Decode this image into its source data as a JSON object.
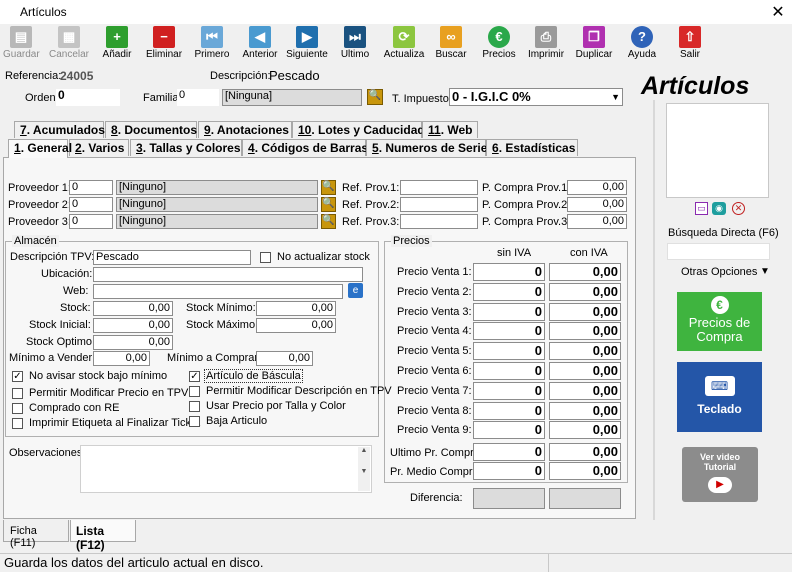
{
  "window": {
    "title": "Artículos",
    "close": "✕"
  },
  "toolbar": {
    "guardar": "Guardar",
    "cancelar": "Cancelar",
    "anadir": "Añadir",
    "eliminar": "Eliminar",
    "primero": "Primero",
    "anterior": "Anterior",
    "siguiente": "Siguiente",
    "ultimo": "Ultimo",
    "actualiza": "Actualiza",
    "buscar": "Buscar",
    "precios": "Precios",
    "imprimir": "Imprimir",
    "duplicar": "Duplicar",
    "ayuda": "Ayuda",
    "salir": "Salir"
  },
  "header": {
    "referencia_label": "Referencia:",
    "referencia_value": "24005",
    "descripcion_label": "Descripción:",
    "descripcion_value": "Pescado",
    "orden_label": "Orden:",
    "orden_value": "0",
    "familia_label": "Familia:",
    "familia_value": "0",
    "familia_name": "[Ninguna]",
    "impuesto_label": "T. Impuesto:",
    "impuesto_value": "0 - I.G.I.C 0%",
    "big_title": "Artículos"
  },
  "tabs_top": [
    {
      "num": "7",
      "label": ". Acumulados"
    },
    {
      "num": "8",
      "label": ". Documentos"
    },
    {
      "num": "9",
      "label": ". Anotaciones"
    },
    {
      "num": "10",
      "label": ". Lotes y Caducidad"
    },
    {
      "num": "11",
      "label": ". Web"
    }
  ],
  "tabs_bottom": [
    {
      "num": "1",
      "label": ". General"
    },
    {
      "num": "2",
      "label": ". Varios"
    },
    {
      "num": "3",
      "label": ". Tallas y Colores"
    },
    {
      "num": "4",
      "label": ". Códigos de Barras"
    },
    {
      "num": "5",
      "label": ". Numeros de Serie"
    },
    {
      "num": "6",
      "label": ". Estadísticas"
    }
  ],
  "proveedores": [
    {
      "label": "Proveedor 1:",
      "code": "0",
      "name": "[Ninguno]",
      "ref_label": "Ref. Prov.1:",
      "ref": "",
      "price_label": "P. Compra Prov.1:",
      "price": "0,00"
    },
    {
      "label": "Proveedor 2:",
      "code": "0",
      "name": "[Ninguno]",
      "ref_label": "Ref. Prov.2:",
      "ref": "",
      "price_label": "P. Compra Prov.2:",
      "price": "0,00"
    },
    {
      "label": "Proveedor 3:",
      "code": "0",
      "name": "[Ninguno]",
      "ref_label": "Ref. Prov.3:",
      "ref": "",
      "price_label": "P. Compra Prov.3:",
      "price": "0,00"
    }
  ],
  "almacen": {
    "title": "Almacén",
    "desc_tpv_label": "Descripción TPV:",
    "desc_tpv_value": "Pescado",
    "no_actualizar": "No actualizar stock",
    "ubicacion_label": "Ubicación:",
    "web_label": "Web:",
    "stock_label": "Stock:",
    "stock_value": "0,00",
    "stock_min_label": "Stock Mínimo:",
    "stock_min_value": "0,00",
    "stock_ini_label": "Stock Inicial:",
    "stock_ini_value": "0,00",
    "stock_max_label": "Stock Máximo:",
    "stock_max_value": "0,00",
    "stock_opt_label": "Stock Optimo:",
    "stock_opt_value": "0,00",
    "min_vender_label": "Mínimo a Vender:",
    "min_vender_value": "0,00",
    "min_comprar_label": "Mínimo a Comprar:",
    "min_comprar_value": "0,00",
    "checks_left": [
      {
        "label": "No avisar stock bajo mínimo",
        "checked": true
      },
      {
        "label": "Permitir Modificar Precio en TPV",
        "checked": false
      },
      {
        "label": "Comprado con RE",
        "checked": false
      },
      {
        "label": "Imprimir Etiqueta al Finalizar Ticket",
        "checked": false
      }
    ],
    "checks_right": [
      {
        "label": "Artículo de Báscula",
        "checked": true
      },
      {
        "label": "Permitir Modificar Descripción en TPV",
        "checked": false
      },
      {
        "label": "Usar Precio por Talla y Color",
        "checked": false
      },
      {
        "label": "Baja Articulo",
        "checked": false
      }
    ]
  },
  "precios": {
    "title": "Precios",
    "col_sin": "sin IVA",
    "col_con": "con IVA",
    "rows": [
      {
        "label": "Precio Venta 1:",
        "sin": "0",
        "con": "0,00"
      },
      {
        "label": "Precio Venta 2:",
        "sin": "0",
        "con": "0,00"
      },
      {
        "label": "Precio Venta 3:",
        "sin": "0",
        "con": "0,00"
      },
      {
        "label": "Precio Venta 4:",
        "sin": "0",
        "con": "0,00"
      },
      {
        "label": "Precio Venta 5:",
        "sin": "0",
        "con": "0,00"
      },
      {
        "label": "Precio Venta 6:",
        "sin": "0",
        "con": "0,00"
      },
      {
        "label": "Precio Venta 7:",
        "sin": "0",
        "con": "0,00"
      },
      {
        "label": "Precio Venta 8:",
        "sin": "0",
        "con": "0,00"
      },
      {
        "label": "Precio Venta 9:",
        "sin": "0",
        "con": "0,00"
      }
    ],
    "ultimo_label": "Ultimo Pr. Compra:",
    "ultimo_sin": "0",
    "ultimo_con": "0,00",
    "medio_label": "Pr. Medio Compra:",
    "medio_sin": "0",
    "medio_con": "0,00",
    "diferencia_label": "Diferencia:"
  },
  "observaciones_label": "Observaciones:",
  "right": {
    "busqueda_label": "Búsqueda Directa (F6)",
    "otras_opciones": "Otras Opciones",
    "precios_compra": "Precios de Compra",
    "teclado": "Teclado",
    "video_line1": "Ver video",
    "video_line2": "Tutorial"
  },
  "bottom_tabs": {
    "ficha": "Ficha (F11)",
    "lista": "Lista (F12)"
  },
  "status": "Guarda los datos del articulo actual en disco."
}
